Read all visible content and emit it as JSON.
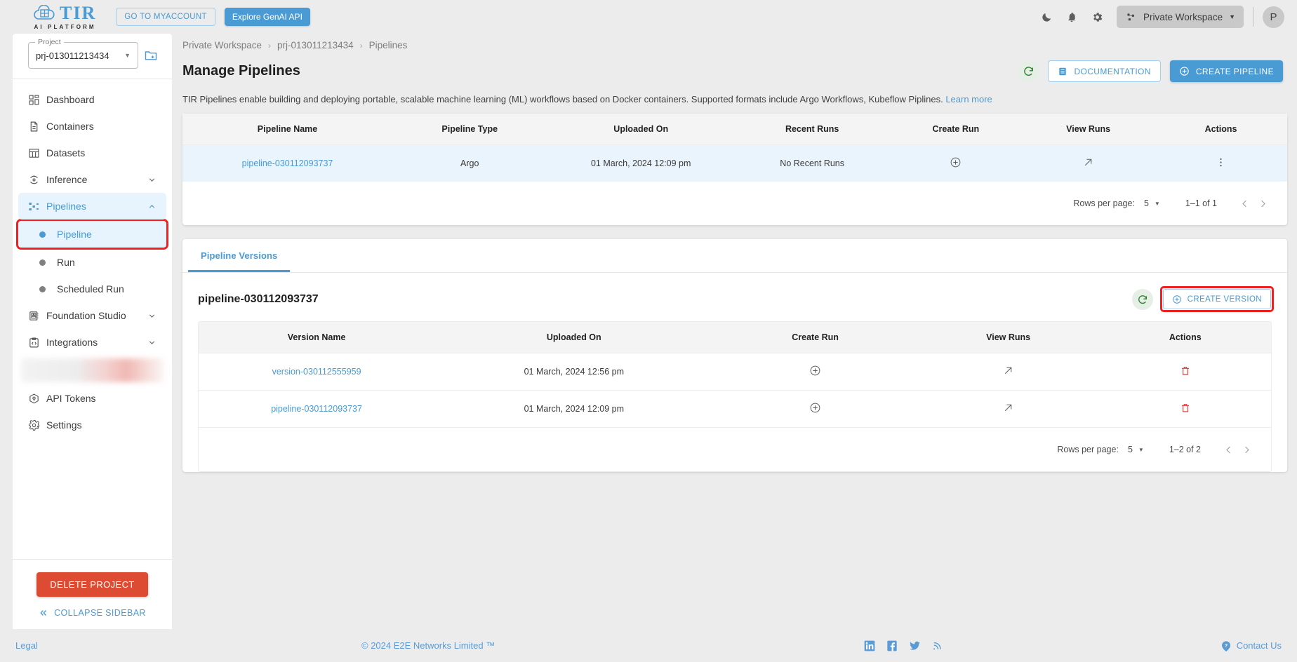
{
  "topbar": {
    "logo_text": "TIR",
    "logo_sub": "AI PLATFORM",
    "myaccount_label": "GO TO MYACCOUNT",
    "genai_label": "Explore GenAI API",
    "icons": [
      "moon-icon",
      "bell-icon",
      "gear-icon"
    ],
    "workspace": "Private Workspace",
    "avatar_initial": "P"
  },
  "sidebar": {
    "project_label": "Project",
    "project_value": "prj-013011213434",
    "items": [
      {
        "label": "Dashboard",
        "icon": "dashboard-icon",
        "expandable": false
      },
      {
        "label": "Containers",
        "icon": "containers-icon",
        "expandable": false
      },
      {
        "label": "Datasets",
        "icon": "datasets-icon",
        "expandable": false
      },
      {
        "label": "Inference",
        "icon": "inference-icon",
        "expandable": true
      },
      {
        "label": "Pipelines",
        "icon": "pipelines-icon",
        "expandable": true,
        "active": true
      }
    ],
    "sub_items": [
      {
        "label": "Pipeline",
        "current": true
      },
      {
        "label": "Run",
        "current": false
      },
      {
        "label": "Scheduled Run",
        "current": false
      }
    ],
    "items_after": [
      {
        "label": "Foundation Studio",
        "icon": "foundation-studio-icon",
        "expandable": true
      },
      {
        "label": "Integrations",
        "icon": "integrations-icon",
        "expandable": true
      }
    ],
    "items_tail": [
      {
        "label": "API Tokens",
        "icon": "api-tokens-icon",
        "expandable": false
      },
      {
        "label": "Settings",
        "icon": "settings-icon",
        "expandable": false
      }
    ],
    "delete_label": "DELETE PROJECT",
    "collapse_label": "COLLAPSE SIDEBAR"
  },
  "main": {
    "breadcrumb": [
      "Private Workspace",
      "prj-013011213434",
      "Pipelines"
    ],
    "page_title": "Manage Pipelines",
    "documentation_label": "DOCUMENTATION",
    "create_pipeline_label": "CREATE PIPELINE",
    "description": "TIR Pipelines enable building and deploying portable, scalable machine learning (ML) workflows based on Docker containers. Supported formats include Argo Workflows, Kubeflow Piplines.",
    "learn_more": "Learn more",
    "pipelines_table": {
      "columns": [
        "Pipeline Name",
        "Pipeline Type",
        "Uploaded On",
        "Recent Runs",
        "Create Run",
        "View Runs",
        "Actions"
      ],
      "rows": [
        {
          "name": "pipeline-030112093737",
          "type": "Argo",
          "uploaded_on": "01 March, 2024 12:09 pm",
          "recent_runs": "No Recent Runs",
          "create_run": "plus-circle-icon",
          "view_runs": "arrow-up-right-icon",
          "actions": "more-vertical-icon"
        }
      ],
      "pager": {
        "rows_per_page_label": "Rows per page:",
        "rows_per_page_value": "5",
        "range": "1–1 of 1"
      }
    },
    "tabs": [
      {
        "label": "Pipeline Versions",
        "active": true
      }
    ],
    "versions_section": {
      "title": "pipeline-030112093737",
      "create_version_label": "CREATE VERSION",
      "columns": [
        "Version Name",
        "Uploaded On",
        "Create Run",
        "View Runs",
        "Actions"
      ],
      "rows": [
        {
          "name": "version-030112555959",
          "uploaded_on": "01 March, 2024 12:56 pm",
          "create_run": "plus-circle-icon",
          "view_runs": "arrow-up-right-icon",
          "actions": "delete-icon"
        },
        {
          "name": "pipeline-030112093737",
          "uploaded_on": "01 March, 2024 12:09 pm",
          "create_run": "plus-circle-icon",
          "view_runs": "arrow-up-right-icon",
          "actions": "delete-icon"
        }
      ],
      "pager": {
        "rows_per_page_label": "Rows per page:",
        "rows_per_page_value": "5",
        "range": "1–2 of 2"
      }
    }
  },
  "footer": {
    "legal": "Legal",
    "copyright": "© 2024 E2E Networks Limited ™",
    "social": [
      "linkedin-icon",
      "facebook-icon",
      "twitter-icon",
      "rss-icon"
    ],
    "contact": "Contact Us"
  },
  "colors": {
    "accent": "#4a9ad4",
    "danger": "#dd4b32",
    "highlight_outline": "#ef2020",
    "row_highlight": "#e9f4fc"
  }
}
